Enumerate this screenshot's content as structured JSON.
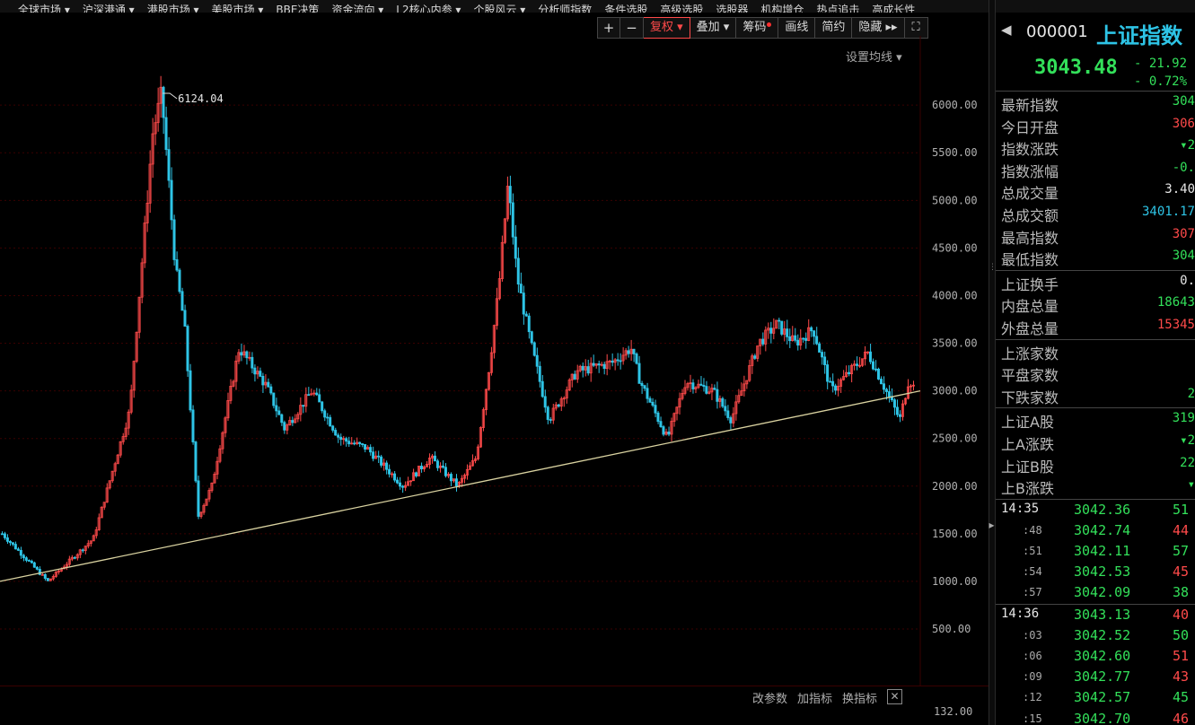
{
  "topnav": [
    "全球市场 ▾",
    "沪深港通 ▾",
    "港股市场 ▾",
    "美股市场 ▾",
    "BBE决策",
    "资金流向 ▾",
    "L2核心内参 ▾",
    "个股风云 ▾",
    "分析师指数",
    "条件选股",
    "高级选股",
    "选股器",
    "机构增仓",
    "热点追击",
    "高成长性"
  ],
  "toolbar": {
    "plus": "+",
    "minus": "−",
    "fuquan": "复权 ▾",
    "diejia": "叠加 ▾",
    "chouma": "筹码",
    "huaxian": "画线",
    "jianyue": "简约",
    "yincang": "隐藏 ▸▸",
    "fullscreen": "⛶"
  },
  "set_ma": "设置均线 ▾",
  "chart_data": {
    "type": "candlestick",
    "peak_label": "6124.04",
    "y_ticks": [
      "6000.00",
      "5500.00",
      "5000.00",
      "4500.00",
      "4000.00",
      "3500.00",
      "3000.00",
      "2500.00",
      "2000.00",
      "1500.00",
      "1000.00",
      "500.00"
    ],
    "ylim": [
      500,
      6124
    ],
    "trendline": [
      [
        0,
        1000
      ],
      [
        1,
        3000
      ]
    ],
    "price_path": [
      [
        0,
        1500
      ],
      [
        0.05,
        1000
      ],
      [
        0.1,
        1450
      ],
      [
        0.14,
        2800
      ],
      [
        0.165,
        5700
      ],
      [
        0.175,
        6124
      ],
      [
        0.19,
        4300
      ],
      [
        0.2,
        3700
      ],
      [
        0.215,
        1680
      ],
      [
        0.23,
        2000
      ],
      [
        0.26,
        3450
      ],
      [
        0.29,
        3050
      ],
      [
        0.31,
        2600
      ],
      [
        0.34,
        3000
      ],
      [
        0.37,
        2500
      ],
      [
        0.4,
        2400
      ],
      [
        0.44,
        2000
      ],
      [
        0.47,
        2300
      ],
      [
        0.5,
        2000
      ],
      [
        0.52,
        2300
      ],
      [
        0.535,
        3300
      ],
      [
        0.545,
        4100
      ],
      [
        0.555,
        5170
      ],
      [
        0.565,
        4200
      ],
      [
        0.58,
        3500
      ],
      [
        0.6,
        2700
      ],
      [
        0.63,
        3200
      ],
      [
        0.67,
        3300
      ],
      [
        0.69,
        3450
      ],
      [
        0.7,
        3100
      ],
      [
        0.73,
        2500
      ],
      [
        0.75,
        3100
      ],
      [
        0.78,
        3000
      ],
      [
        0.8,
        2700
      ],
      [
        0.83,
        3500
      ],
      [
        0.85,
        3700
      ],
      [
        0.87,
        3500
      ],
      [
        0.89,
        3650
      ],
      [
        0.91,
        3000
      ],
      [
        0.93,
        3200
      ],
      [
        0.95,
        3400
      ],
      [
        0.97,
        3000
      ],
      [
        0.985,
        2700
      ],
      [
        0.995,
        3130
      ],
      [
        1,
        3043
      ]
    ]
  },
  "subchart": {
    "params": "改参数",
    "add": "加指标",
    "switch": "换指标",
    "close": "✕",
    "tick": "132.00"
  },
  "rp": {
    "back": "◀",
    "code": "000001",
    "name": "上证指数",
    "last": "3043.48",
    "chg": "- 21.92",
    "chg_pct": "- 0.72%",
    "group1": [
      {
        "label": "最新指数",
        "value": "304",
        "cls": "green"
      },
      {
        "label": "今日开盘",
        "value": "306",
        "cls": "red"
      },
      {
        "label": "指数涨跌",
        "value": "▾2",
        "cls": "green"
      },
      {
        "label": "指数涨幅",
        "value": "-0.",
        "cls": "green"
      },
      {
        "label": "总成交量",
        "value": "3.40",
        "cls": "white"
      },
      {
        "label": "总成交额",
        "value": "3401.17",
        "cls": "cyan"
      },
      {
        "label": "最高指数",
        "value": "307",
        "cls": "red"
      },
      {
        "label": "最低指数",
        "value": "304",
        "cls": "green"
      }
    ],
    "group2": [
      {
        "label": "上证换手",
        "value": "0.",
        "cls": "white"
      },
      {
        "label": "内盘总量",
        "value": "18643",
        "cls": "green"
      },
      {
        "label": "外盘总量",
        "value": "15345",
        "cls": "red"
      }
    ],
    "group3": [
      {
        "label": "上涨家数",
        "value": "",
        "cls": "red"
      },
      {
        "label": "平盘家数",
        "value": "",
        "cls": "white"
      },
      {
        "label": "下跌家数",
        "value": "2",
        "cls": "green"
      }
    ],
    "group4": [
      {
        "label": "上证A股",
        "value": "319",
        "cls": "green"
      },
      {
        "label": "上A涨跌",
        "value": "▾2",
        "cls": "green"
      },
      {
        "label": "上证B股",
        "value": "22",
        "cls": "green"
      },
      {
        "label": "上B涨跌",
        "value": "▾",
        "cls": "green"
      }
    ],
    "ticks1": [
      {
        "time": "14:35",
        "sub": false,
        "price": "3042.36",
        "vol": "51",
        "cls": "green"
      },
      {
        "time": ":48",
        "sub": true,
        "price": "3042.74",
        "vol": "44",
        "cls": "red"
      },
      {
        "time": ":51",
        "sub": true,
        "price": "3042.11",
        "vol": "57",
        "cls": "green"
      },
      {
        "time": ":54",
        "sub": true,
        "price": "3042.53",
        "vol": "45",
        "cls": "red"
      },
      {
        "time": ":57",
        "sub": true,
        "price": "3042.09",
        "vol": "38",
        "cls": "green"
      }
    ],
    "ticks2": [
      {
        "time": "14:36",
        "sub": false,
        "price": "3043.13",
        "vol": "40",
        "cls": "red"
      },
      {
        "time": ":03",
        "sub": true,
        "price": "3042.52",
        "vol": "50",
        "cls": "green"
      },
      {
        "time": ":06",
        "sub": true,
        "price": "3042.60",
        "vol": "51",
        "cls": "red"
      },
      {
        "time": ":09",
        "sub": true,
        "price": "3042.77",
        "vol": "43",
        "cls": "red"
      },
      {
        "time": ":12",
        "sub": true,
        "price": "3042.57",
        "vol": "45",
        "cls": "green"
      },
      {
        "time": ":15",
        "sub": true,
        "price": "3042.70",
        "vol": "46",
        "cls": "red"
      }
    ]
  }
}
